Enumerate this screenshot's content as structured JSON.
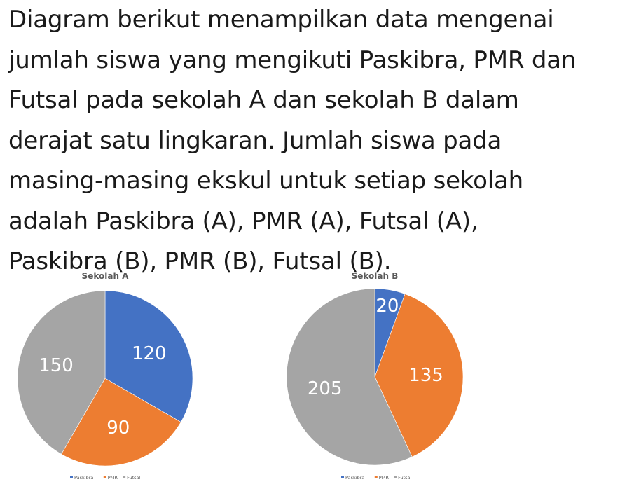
{
  "question": {
    "lines": [
      "Diagram berikut menampilkan data mengenai",
      "jumlah siswa yang mengikuti Paskibra, PMR dan",
      "Futsal pada sekolah A dan sekolah B dalam",
      "derajat satu lingkaran. Jumlah siswa pada",
      "masing-masing ekskul untuk setiap sekolah",
      "adalah Paskibra (A), PMR (A), Futsal (A),",
      "Paskibra (B), PMR (B), Futsal (B)."
    ]
  },
  "colors": {
    "Paskibra": "#4472C4",
    "PMR": "#ED7D31",
    "Futsal": "#A5A5A5",
    "text": "#1a1a1a",
    "chart_title": "#595959"
  },
  "chart_data": [
    {
      "type": "pie",
      "title": "Sekolah A",
      "categories": [
        "Paskibra",
        "PMR",
        "Futsal"
      ],
      "values": [
        120,
        90,
        150
      ],
      "data_labels": [
        "120",
        "90",
        "150"
      ],
      "legend": "bottom"
    },
    {
      "type": "pie",
      "title": "Sekolah B",
      "categories": [
        "Paskibra",
        "PMR",
        "Futsal"
      ],
      "values": [
        20,
        135,
        205
      ],
      "data_labels": [
        "20",
        "135",
        "205"
      ],
      "legend": "bottom"
    }
  ]
}
